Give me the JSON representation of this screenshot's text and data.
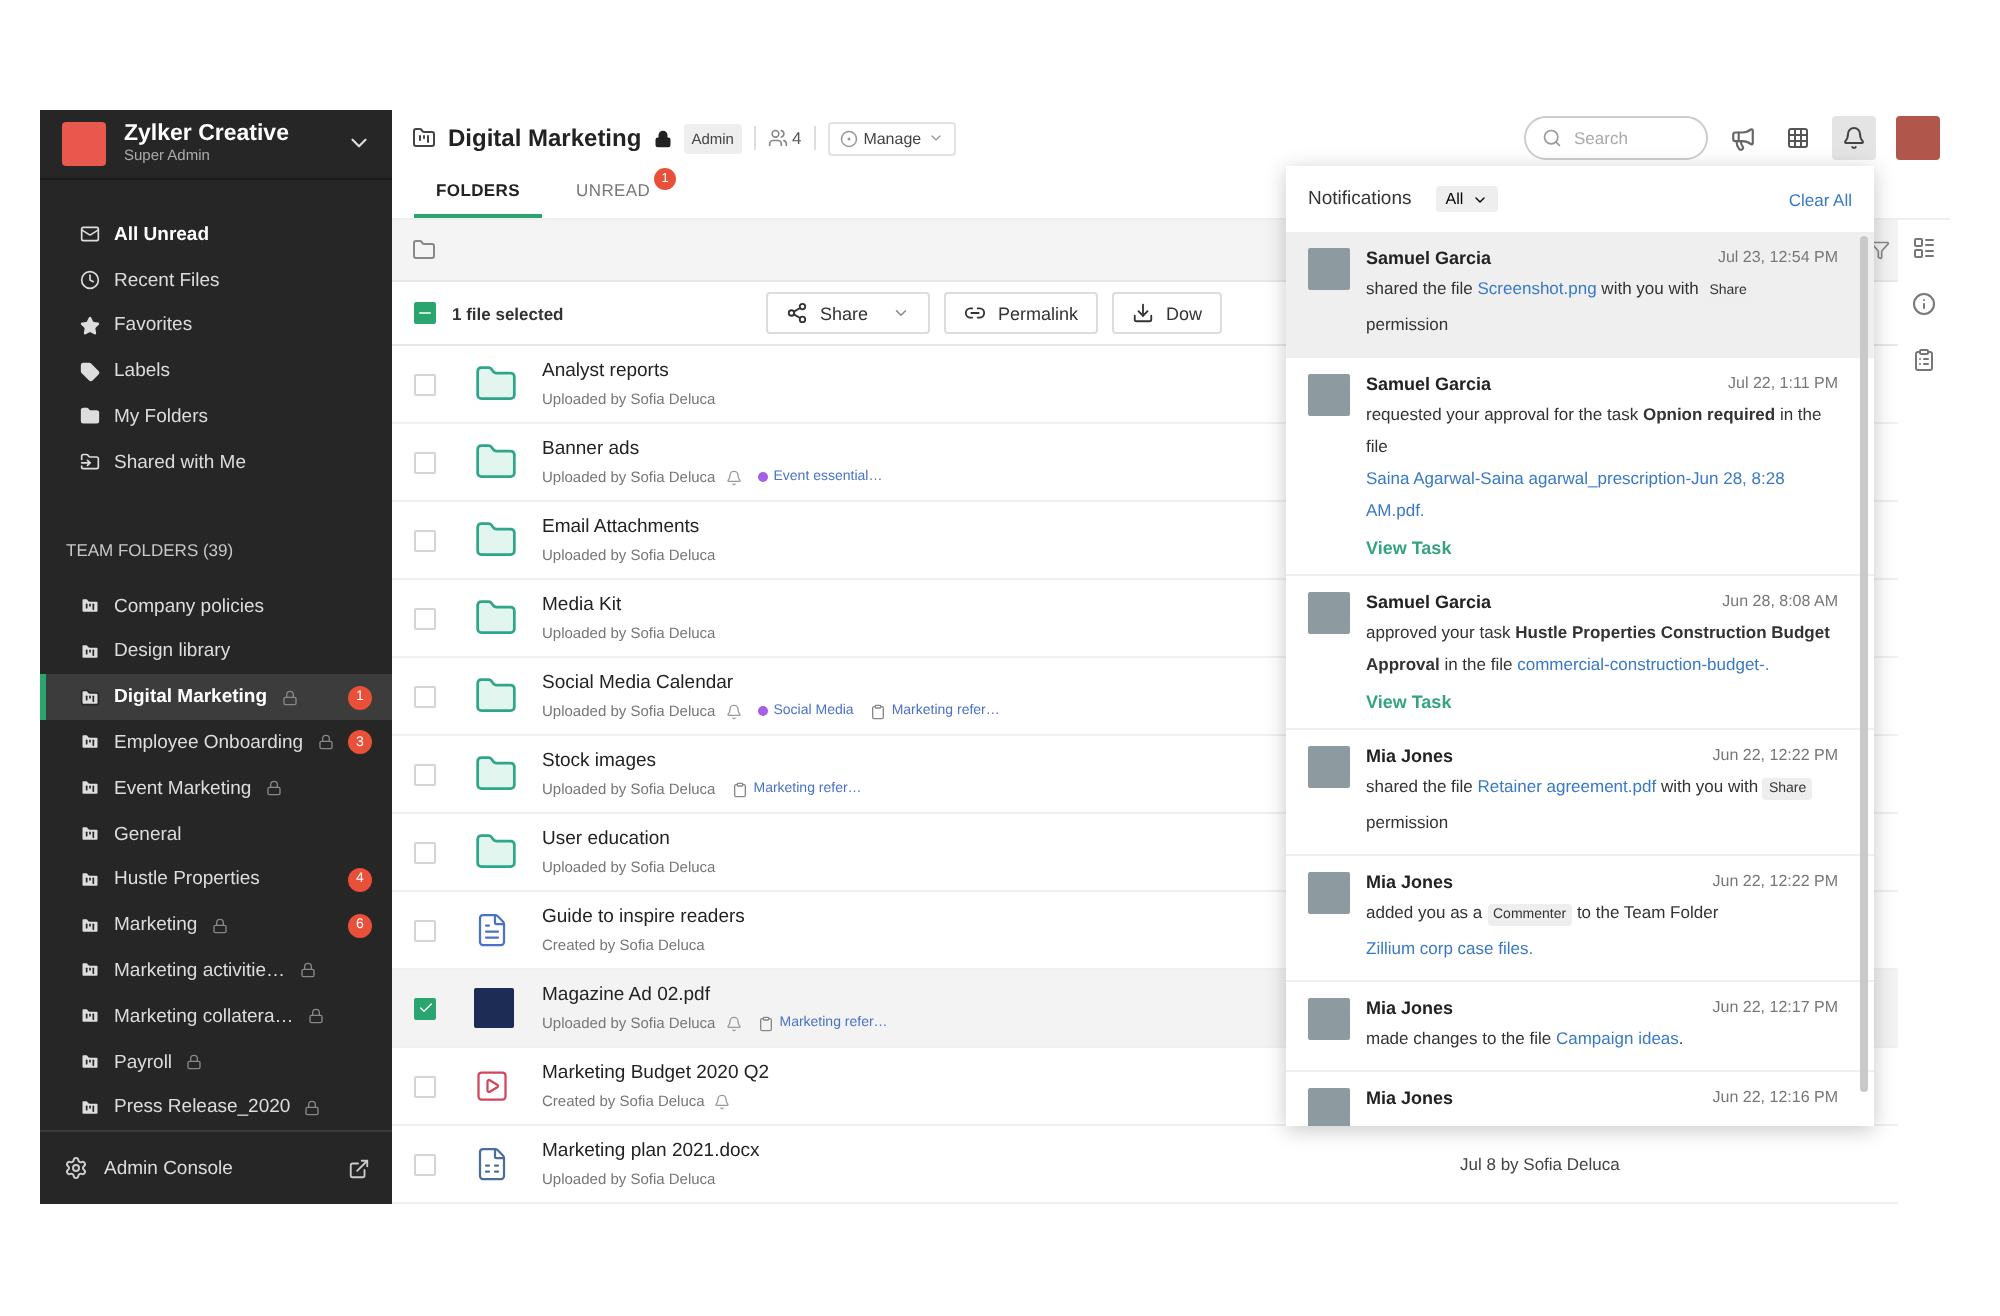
{
  "workspace": {
    "name": "Zylker Creative",
    "role": "Super Admin"
  },
  "sidebar": {
    "nav": [
      {
        "kind": "unread",
        "label": "All Unread",
        "bold": true,
        "selected": false
      },
      {
        "kind": "recent",
        "label": "Recent Files",
        "bold": false,
        "selected": false
      },
      {
        "kind": "favorites",
        "label": "Favorites",
        "bold": false,
        "selected": false
      },
      {
        "kind": "labels",
        "label": "Labels",
        "bold": false,
        "selected": false
      },
      {
        "kind": "my-folders",
        "label": "My Folders",
        "bold": false,
        "selected": false
      },
      {
        "kind": "shared",
        "label": "Shared with Me",
        "bold": false,
        "selected": false
      }
    ],
    "team_heading": "TEAM FOLDERS (39)",
    "team_folders": [
      {
        "label": "Company policies",
        "locked": false,
        "selected": false
      },
      {
        "label": "Design library",
        "locked": false,
        "selected": false
      },
      {
        "label": "Digital Marketing",
        "locked": true,
        "badge": "1",
        "selected": true
      },
      {
        "label": "Employee Onboarding",
        "locked": true,
        "badge": "3",
        "selected": false
      },
      {
        "label": "Event Marketing",
        "locked": true,
        "selected": false
      },
      {
        "label": "General",
        "locked": false,
        "selected": false
      },
      {
        "label": "Hustle Properties",
        "locked": false,
        "badge": "4",
        "selected": false
      },
      {
        "label": "Marketing",
        "locked": true,
        "badge": "6",
        "selected": false
      },
      {
        "label": "Marketing activitie…",
        "locked": true,
        "selected": false
      },
      {
        "label": "Marketing collatera…",
        "locked": true,
        "selected": false
      },
      {
        "label": "Payroll",
        "locked": true,
        "selected": false
      },
      {
        "label": "Press Release_2020",
        "locked": true,
        "selected": false
      }
    ],
    "footer": "Admin Console"
  },
  "header": {
    "title": "Digital Marketing",
    "locked": true,
    "role": "Admin",
    "members": "4",
    "manage": "Manage",
    "search_placeholder": "Search"
  },
  "tabs": [
    {
      "label": "FOLDERS",
      "selected": true
    },
    {
      "label": "UNREAD",
      "badge": "1",
      "selected": false
    }
  ],
  "selection": {
    "checked": true,
    "text": "1 file selected",
    "buttons": [
      {
        "kind": "share",
        "label": "Share",
        "caret": true
      },
      {
        "kind": "link",
        "label": "Permalink",
        "caret": false
      },
      {
        "kind": "download",
        "label": "Dow",
        "caret": false
      }
    ]
  },
  "files": [
    {
      "kind": "folder",
      "name": "Analyst reports",
      "meta": "Uploaded by Sofia Deluca",
      "watched": false,
      "checked": false
    },
    {
      "kind": "folder",
      "name": "Banner ads",
      "meta": "Uploaded by Sofia Deluca",
      "watched": true,
      "checked": false,
      "tags": [
        {
          "kind": "label",
          "text": "Event essential…",
          "color": "#a55ee6"
        }
      ]
    },
    {
      "kind": "folder",
      "name": "Email Attachments",
      "meta": "Uploaded by Sofia Deluca",
      "watched": false,
      "checked": false
    },
    {
      "kind": "folder",
      "name": "Media Kit",
      "meta": "Uploaded by Sofia Deluca",
      "watched": false,
      "checked": false
    },
    {
      "kind": "folder",
      "name": "Social Media Calendar",
      "meta": "Uploaded by Sofia Deluca",
      "watched": true,
      "checked": false,
      "tags": [
        {
          "kind": "label",
          "text": "Social Media",
          "color": "#a55ee6"
        },
        {
          "kind": "folder-ref",
          "text": "Marketing refer…"
        }
      ]
    },
    {
      "kind": "folder",
      "name": "Stock images",
      "meta": "Uploaded by Sofia Deluca",
      "watched": false,
      "checked": false,
      "tags": [
        {
          "kind": "folder-ref",
          "text": "Marketing refer…"
        }
      ]
    },
    {
      "kind": "folder",
      "name": "User education",
      "meta": "Uploaded by Sofia Deluca",
      "watched": false,
      "checked": false
    },
    {
      "kind": "guide",
      "name": "Guide to inspire readers",
      "meta": "Created by Sofia Deluca",
      "watched": false,
      "checked": false
    },
    {
      "kind": "image",
      "name": "Magazine Ad 02.pdf",
      "meta": "Uploaded by Sofia Deluca",
      "watched": true,
      "checked": true,
      "tags": [
        {
          "kind": "folder-ref",
          "text": "Marketing refer…"
        }
      ]
    },
    {
      "kind": "video",
      "name": "Marketing Budget 2020 Q2",
      "meta": "Created by Sofia Deluca",
      "watched": true,
      "checked": false
    },
    {
      "kind": "doc",
      "name": "Marketing plan 2021.docx",
      "meta": "Uploaded by Sofia Deluca",
      "watched": false,
      "checked": false,
      "modified": "Jul 8 by Sofia Deluca"
    }
  ],
  "notifications": {
    "title": "Notifications",
    "filter": "All",
    "clear": "Clear All",
    "items": [
      {
        "name": "Samuel Garcia",
        "time": "Jul 23, 12:54 PM",
        "unread": true,
        "message": [
          {
            "kind": "text",
            "text": "shared the file "
          },
          {
            "kind": "link",
            "text": "Screenshot.png"
          },
          {
            "kind": "text",
            "text": " with you with "
          },
          {
            "kind": "chip",
            "text": "Share"
          },
          {
            "kind": "text",
            "text": " permission"
          }
        ]
      },
      {
        "name": "Samuel Garcia",
        "time": "Jul 22, 1:11 PM",
        "unread": false,
        "message": [
          {
            "kind": "text",
            "text": "requested your approval for the task "
          },
          {
            "kind": "bold",
            "text": "Opnion required"
          },
          {
            "kind": "text",
            "text": " in the file "
          },
          {
            "kind": "link",
            "text": "Saina Agarwal-Saina agarwal_prescription-Jun 28, 8:28 AM.pdf."
          }
        ],
        "action": "View Task"
      },
      {
        "name": "Samuel Garcia",
        "time": "Jun 28, 8:08 AM",
        "unread": false,
        "message": [
          {
            "kind": "text",
            "text": "approved your task "
          },
          {
            "kind": "bold",
            "text": "Hustle Properties Construction Budget Approval"
          },
          {
            "kind": "text",
            "text": " in the file "
          },
          {
            "kind": "link",
            "text": "commercial-construction-budget-."
          }
        ],
        "action": "View Task"
      },
      {
        "name": "Mia Jones",
        "time": "Jun 22, 12:22 PM",
        "unread": false,
        "message": [
          {
            "kind": "text",
            "text": "shared the file "
          },
          {
            "kind": "link",
            "text": "Retainer agreement.pdf"
          },
          {
            "kind": "text",
            "text": " with you with "
          },
          {
            "kind": "chip",
            "text": "Share"
          },
          {
            "kind": "text",
            "text": " permission"
          }
        ]
      },
      {
        "name": "Mia Jones",
        "time": "Jun 22, 12:22 PM",
        "unread": false,
        "message": [
          {
            "kind": "text",
            "text": "added you as a "
          },
          {
            "kind": "chip",
            "text": "Commenter"
          },
          {
            "kind": "text",
            "text": " to the Team Folder "
          },
          {
            "kind": "link",
            "text": "Zillium corp case files."
          }
        ]
      },
      {
        "name": "Mia Jones",
        "time": "Jun 22, 12:17 PM",
        "unread": false,
        "message": [
          {
            "kind": "text",
            "text": "made changes to the file "
          },
          {
            "kind": "link",
            "text": "Campaign ideas"
          },
          {
            "kind": "text",
            "text": "."
          }
        ]
      },
      {
        "name": "Mia Jones",
        "time": "Jun 22, 12:16 PM",
        "unread": false
      }
    ]
  }
}
